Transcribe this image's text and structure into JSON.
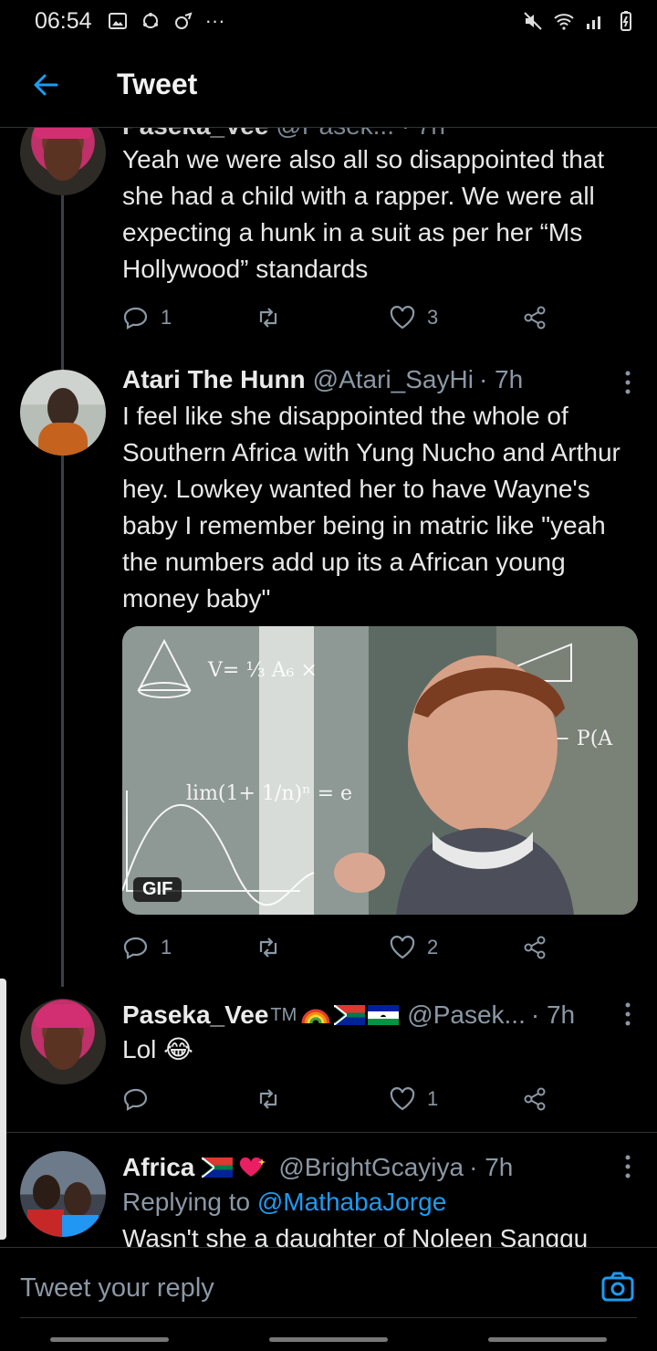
{
  "status": {
    "time": "06:54",
    "more": "···"
  },
  "header": {
    "title": "Tweet"
  },
  "tweets": [
    {
      "name_partial": "Paseka_Vee",
      "meta_partial": "@Pasek...  · 7h",
      "text": "Yeah we were also all so disappointed that she had a child with a rapper. We were all expecting a hunk in a suit as per her “Ms Hollywood” standards",
      "replies": "1",
      "retweets": "",
      "likes": "3"
    },
    {
      "name": "Atari The Hunn",
      "handle": "@Atari_SayHi",
      "time": "· 7h",
      "text": "I feel like she disappointed the whole of Southern Africa with Yung Nucho and Arthur hey. Lowkey wanted her to have Wayne's baby I remember being in matric like \"yeah the numbers add up its a African  young money baby\"",
      "media_badge": "GIF",
      "replies": "1",
      "retweets": "",
      "likes": "2"
    },
    {
      "name": "Paseka_Vee",
      "tm": "TM",
      "handle": "@Pasek...",
      "time": "· 7h",
      "text": "Lol 😂",
      "replies": "",
      "retweets": "",
      "likes": "1"
    },
    {
      "name": "Africa",
      "handle": "@BrightGcayiya",
      "time": "· 7h",
      "replying_prefix": "Replying to",
      "replying_to": "@MathabaJorge",
      "text": "Wasn't she a daughter of Noleen Sangqu"
    }
  ],
  "reply_box": {
    "placeholder": "Tweet your reply"
  },
  "icons": [
    "back-arrow-icon",
    "reply-icon",
    "retweet-icon",
    "like-icon",
    "share-icon",
    "more-icon",
    "camera-icon"
  ],
  "colors": {
    "accent": "#1d9bf0",
    "muted": "#8b98a5",
    "background": "#000000"
  }
}
